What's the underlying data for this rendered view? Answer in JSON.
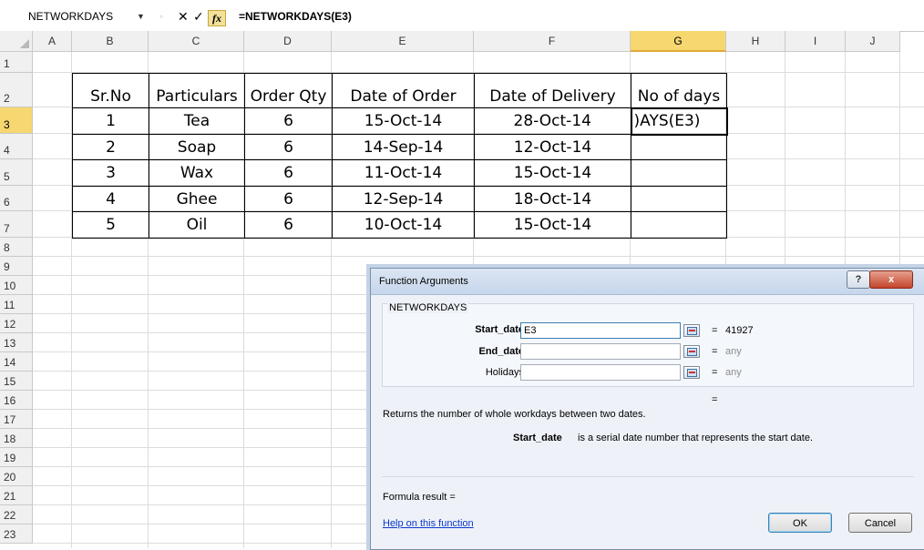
{
  "formula_bar": {
    "name_box": "NETWORKDAYS",
    "cancel_icon": "✕",
    "enter_icon": "✓",
    "fx_label": "fx",
    "formula": "=NETWORKDAYS(E3)"
  },
  "columns": [
    "A",
    "B",
    "C",
    "D",
    "E",
    "F",
    "G",
    "H",
    "I",
    "J"
  ],
  "selected_column": "G",
  "rows": [
    "1",
    "2",
    "3",
    "4",
    "5",
    "6",
    "7",
    "8",
    "9",
    "10",
    "11",
    "12",
    "13",
    "14",
    "15",
    "16",
    "17",
    "18",
    "19",
    "20",
    "21",
    "22",
    "23"
  ],
  "selected_row": "3",
  "table": {
    "headers": [
      "Sr.No",
      "Particulars",
      "Order Qty",
      "Date  of Order",
      "Date of Delivery",
      "No of days"
    ],
    "rows": [
      [
        "1",
        "Tea",
        "6",
        "15-Oct-14",
        "28-Oct-14",
        ")AYS(E3)"
      ],
      [
        "2",
        "Soap",
        "6",
        "14-Sep-14",
        "12-Oct-14",
        ""
      ],
      [
        "3",
        "Wax",
        "6",
        "11-Oct-14",
        "15-Oct-14",
        ""
      ],
      [
        "4",
        "Ghee",
        "6",
        "12-Sep-14",
        "18-Oct-14",
        ""
      ],
      [
        "5",
        "Oil",
        "6",
        "10-Oct-14",
        "15-Oct-14",
        ""
      ]
    ]
  },
  "dialog": {
    "title": "Function Arguments",
    "help_button": "?",
    "close_button": "x",
    "function_name": "NETWORKDAYS",
    "args": [
      {
        "label": "Start_date",
        "value": "E3",
        "result": "41927"
      },
      {
        "label": "End_date",
        "value": "",
        "result": "any"
      },
      {
        "label": "Holidays",
        "value": "",
        "result": "any"
      }
    ],
    "equals": "=",
    "description": "Returns the number of whole workdays between two dates.",
    "arg_desc_name": "Start_date",
    "arg_desc_text": "is a serial date number that represents the start date.",
    "formula_result": "Formula result =",
    "help_link": "Help on this function",
    "ok": "OK",
    "cancel": "Cancel"
  }
}
